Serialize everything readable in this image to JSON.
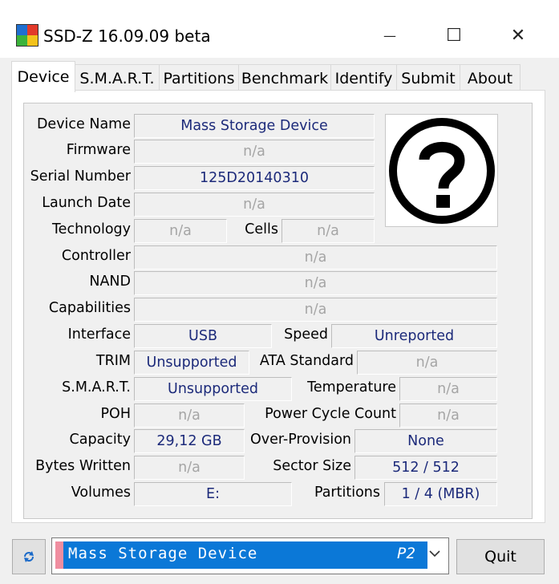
{
  "window": {
    "title": "SSD-Z 16.09.09 beta",
    "minimize_glyph": "—",
    "maximize_glyph": "☐",
    "close_glyph": "✕"
  },
  "tabs": [
    "Device",
    "S.M.A.R.T.",
    "Partitions",
    "Benchmark",
    "Identify",
    "Submit",
    "About"
  ],
  "active_tab": "Device",
  "device": {
    "device_name_label": "Device Name",
    "device_name": "Mass Storage Device",
    "firmware_label": "Firmware",
    "firmware": "n/a",
    "serial_label": "Serial Number",
    "serial": "125D20140310",
    "launch_label": "Launch Date",
    "launch": "n/a",
    "technology_label": "Technology",
    "technology": "n/a",
    "cells_label": "Cells",
    "cells": "n/a",
    "controller_label": "Controller",
    "controller": "n/a",
    "nand_label": "NAND",
    "nand": "n/a",
    "capabilities_label": "Capabilities",
    "capabilities": "n/a",
    "interface_label": "Interface",
    "interface": "USB",
    "speed_label": "Speed",
    "speed": "Unreported",
    "trim_label": "TRIM",
    "trim": "Unsupported",
    "ata_label": "ATA Standard",
    "ata": "n/a",
    "smart_label": "S.M.A.R.T.",
    "smart": "Unsupported",
    "temperature_label": "Temperature",
    "temperature": "n/a",
    "poh_label": "POH",
    "poh": "n/a",
    "power_cycle_label": "Power Cycle Count",
    "power_cycle": "n/a",
    "capacity_label": "Capacity",
    "capacity": "29,12 GB",
    "overprov_label": "Over-Provision",
    "overprov": "None",
    "bytes_written_label": "Bytes Written",
    "bytes_written": "n/a",
    "sector_label": "Sector Size",
    "sector": "512 / 512",
    "volumes_label": "Volumes",
    "volumes": "E:",
    "partitions_label": "Partitions",
    "partitions": "1 / 4 (MBR)",
    "image_icon": "question-mark-icon"
  },
  "bottom": {
    "refresh_icon": "refresh-icon",
    "selected_device": "Mass Storage Device",
    "selected_tag": "P2",
    "quit_label": "Quit"
  },
  "colors": {
    "value_text": "#1c2a7a",
    "na_text": "#a5a5a5",
    "selection": "#0b78d7",
    "selection_stripe": "#f08ea0"
  }
}
